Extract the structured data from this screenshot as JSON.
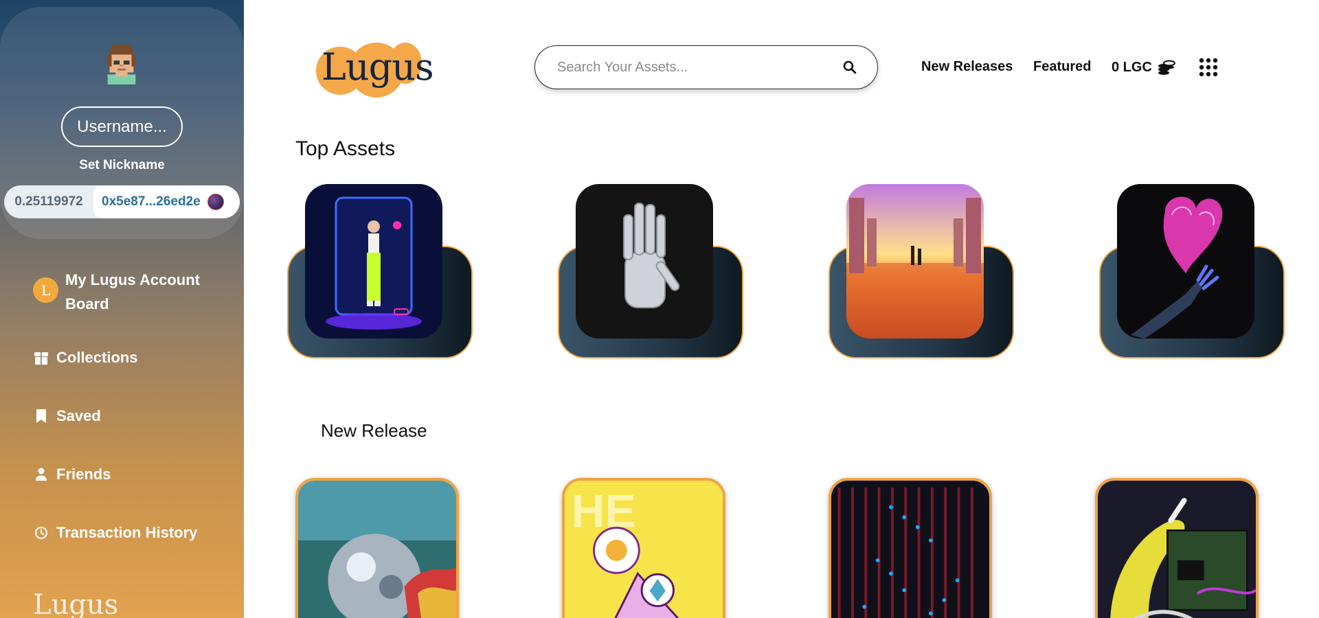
{
  "sidebar": {
    "username_placeholder": "Username...",
    "set_nickname_label": "Set Nickname",
    "wallet": {
      "balance": "0.25119972",
      "address": "0x5e87...26ed2e"
    },
    "account_badge": "L",
    "nav": [
      {
        "label": "My Lugus Account Board",
        "icon": "lugus-badge-icon"
      },
      {
        "label": "Collections",
        "icon": "box-icon"
      },
      {
        "label": "Saved",
        "icon": "bookmark-icon"
      },
      {
        "label": "Friends",
        "icon": "person-icon"
      },
      {
        "label": "Transaction History",
        "icon": "clock-icon"
      }
    ],
    "footer_logo": "Lugus"
  },
  "header": {
    "logo_text": "Lugus",
    "search_placeholder": "Search Your Assets...",
    "nav": {
      "new_releases": "New Releases",
      "featured": "Featured",
      "balance": "0 LGC"
    }
  },
  "sections": {
    "top_assets_title": "Top Assets",
    "new_release_title": "New Release"
  },
  "colors": {
    "accent_orange": "#f0a241",
    "sidebar_top": "#1f4466",
    "sidebar_bottom": "#e3a24f",
    "address_blue": "#2b6e9b"
  }
}
